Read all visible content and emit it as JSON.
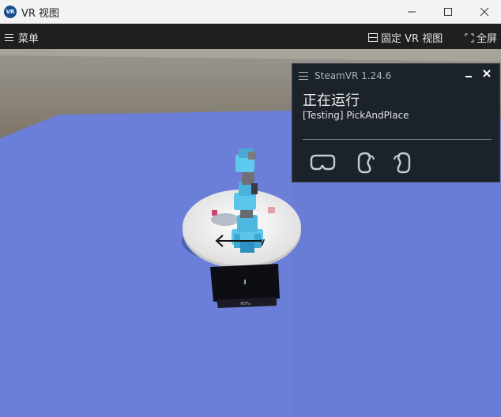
{
  "window": {
    "icon_text": "VR",
    "title": "VR 视图",
    "min_glyph": "—",
    "max_glyph": "☐",
    "close_glyph": "✕"
  },
  "menubar": {
    "menu_label": "菜单",
    "fix_view_label": "固定 VR 视图",
    "fullscreen_label": "全屏"
  },
  "steamvr": {
    "title": "SteamVR 1.24.6",
    "status": "正在运行",
    "app": "[Testing] PickAndPlace",
    "devices": [
      "headset-icon",
      "controller-left-icon",
      "controller-right-icon"
    ]
  },
  "scene": {
    "axis_label": "y",
    "screen_label": "ЯDFь"
  },
  "colors": {
    "sky": "#8c8574",
    "floor": "#6b7ed6",
    "robot": "#4fc3e8",
    "panel_bg": "#1c2229"
  }
}
